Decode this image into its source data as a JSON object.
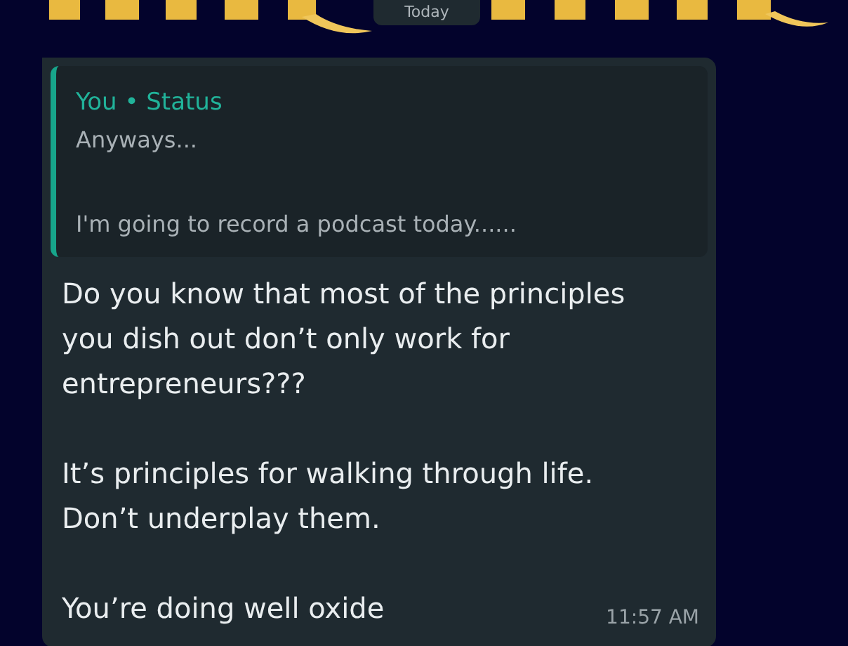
{
  "date_pill": "Today",
  "message": {
    "quote": {
      "author": "You • Status",
      "lines": [
        "Anyways...",
        "I'm going to record a podcast today......"
      ]
    },
    "paragraphs": [
      "Do you know that most of the principles you dish out don’t only work for entrepreneurs???",
      "It’s principles for walking through life. Don’t underplay them.",
      "You’re doing well oxide"
    ],
    "time": "11:57 AM"
  }
}
